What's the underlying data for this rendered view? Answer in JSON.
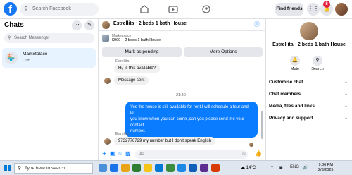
{
  "topbar": {
    "logo": "f",
    "search_placeholder": "Search Facebook",
    "find_friends": "Find friends",
    "notification_count": "8"
  },
  "left": {
    "title": "Chats",
    "search_placeholder": "Search Messenger",
    "chats": [
      {
        "name": "Marketplace",
        "time": "· 1m"
      }
    ]
  },
  "conversation": {
    "title": "Estrellita · 2 beds 1 bath House",
    "listing_label": "Marketplace",
    "listing_sub": "$900 – 2 beds 1 bath House",
    "mark_pending": "Mark as pending",
    "more_options": "More Options",
    "sender_name_1": "Estrellita",
    "msg_1": "Hi, is this available?",
    "msg_sent": "Message sent",
    "timestamp": "21:30",
    "msg_out_line1": "Yes the house is still available for rent.I will schedule a tour and let",
    "msg_out_line2": "you know when you can come ,can you please send me your contact",
    "msg_out_line3": "number.",
    "sender_name_2": "Estrellita",
    "msg_2": "9732776729 my number but I don't speak English",
    "composer_placeholder": "Aa"
  },
  "right": {
    "title": "Estrellita · 2 beds 1 bath House",
    "mute": "Mute",
    "search": "Search",
    "menu": [
      "Customise chat",
      "Chat members",
      "Media, files and links",
      "Privacy and support"
    ]
  },
  "taskbar": {
    "search_placeholder": "Type here to search",
    "temperature": "14°C",
    "language": "ENG",
    "time": "9:36 PM",
    "date": "2/3/2025"
  },
  "colors": {
    "accent": "#0a7cff",
    "fb_blue": "#1877f2",
    "badge": "#e41e3f"
  }
}
